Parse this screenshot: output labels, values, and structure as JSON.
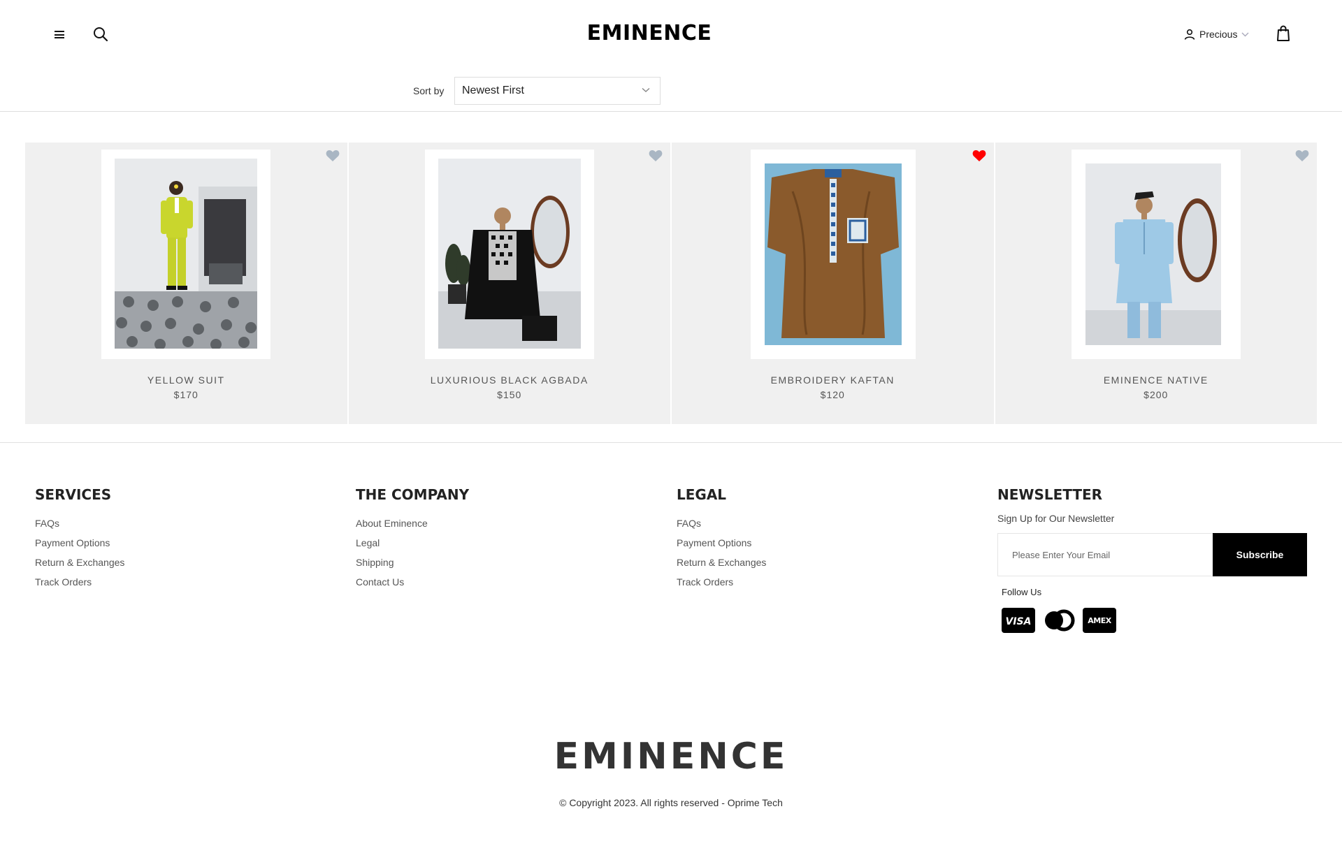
{
  "header": {
    "brand": "EMINENCE",
    "user_name": "Precious",
    "icons": {
      "menu": "hamburger-icon",
      "search": "search-icon",
      "user": "user-icon",
      "cart": "shopping-bag-icon"
    }
  },
  "sort": {
    "label": "Sort by",
    "selected": "Newest First"
  },
  "products": [
    {
      "name": "YELLOW SUIT",
      "price": "$170",
      "favorited": false
    },
    {
      "name": "LUXURIOUS BLACK AGBADA",
      "price": "$150",
      "favorited": false
    },
    {
      "name": "EMBROIDERY KAFTAN",
      "price": "$120",
      "favorited": true
    },
    {
      "name": "EMINENCE NATIVE",
      "price": "$200",
      "favorited": false
    }
  ],
  "colors": {
    "heart_default": "#a9b6c3",
    "heart_active": "#ff0000",
    "card_bg": "#f0f0f0",
    "button_bg": "#000000"
  },
  "footer": {
    "services": {
      "title": "SERVICES",
      "links": [
        "FAQs",
        "Payment Options",
        "Return & Exchanges",
        "Track Orders"
      ]
    },
    "company": {
      "title": "THE COMPANY",
      "links": [
        "About Eminence",
        "Legal",
        "Shipping",
        "Contact Us"
      ]
    },
    "legal": {
      "title": "LEGAL",
      "links": [
        "FAQs",
        "Payment Options",
        "Return & Exchanges",
        "Track Orders"
      ]
    },
    "newsletter": {
      "title": "NEWSLETTER",
      "subtitle": "Sign Up for Our Newsletter",
      "placeholder": "Please Enter Your Email",
      "button": "Subscribe",
      "follow": "Follow Us",
      "payment_icons": [
        "visa-icon",
        "mastercard-icon",
        "amex-icon"
      ],
      "visa_text": "VISA",
      "amex_text": "AMEX"
    },
    "brand": "EMINENCE",
    "copyright": "© Copyright 2023. All rights reserved - Oprime Tech"
  }
}
